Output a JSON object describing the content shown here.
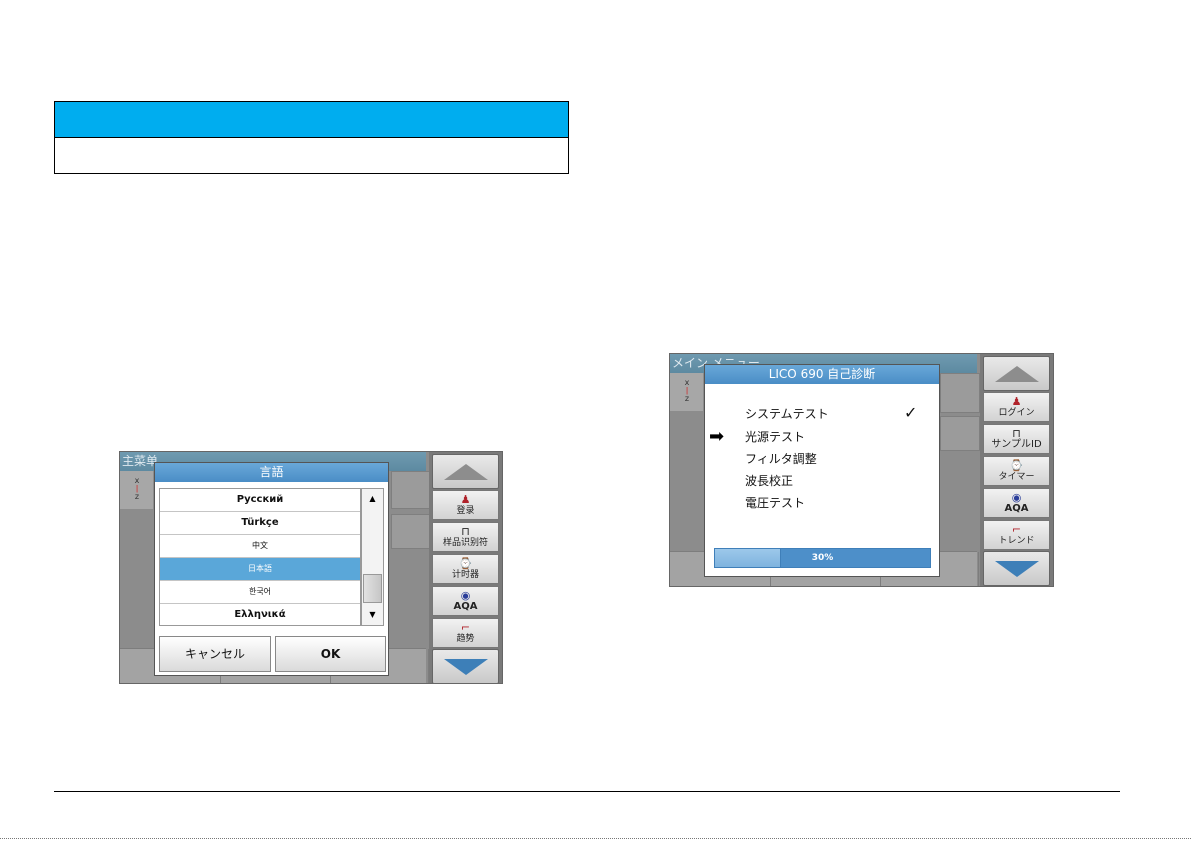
{
  "left_screen": {
    "bg_title": "主菜单",
    "bottom_labels": [
      "",
      "",
      ""
    ],
    "dialog_title": "言語",
    "languages": [
      "Русский",
      "Türkçe",
      "中文",
      "日本語",
      "한국어",
      "Ελληνικά"
    ],
    "selected_language": "日本語",
    "cancel_label": "キャンセル",
    "ok_label": "OK",
    "side": {
      "login_label": "登录",
      "sample_id_label": "样品识别符",
      "timer_label": "计时器",
      "aqa_label": "AQA",
      "trend_label": "趋势"
    }
  },
  "right_screen": {
    "bg_title": "メイン メニュー",
    "dialog_title": "LICO 690  自己診断",
    "items": [
      "システムテスト",
      "光源テスト",
      "フィルタ調整",
      "波長校正",
      "電圧テスト"
    ],
    "completed_item": "システムテスト",
    "current_item": "光源テスト",
    "progress": 0.3,
    "progress_label": "30%",
    "side": {
      "login_label": "ログイン",
      "sample_id_label": "サンプルID",
      "timer_label": "タイマー",
      "aqa_label": "AQA",
      "trend_label": "トレンド"
    }
  },
  "icons": {
    "arrow_up": "triangle-up",
    "arrow_down": "triangle-down",
    "login": "person-icon",
    "sample_id": "sample-vial-icon",
    "timer": "timer-icon",
    "aqa": "aqa-icon",
    "trend": "trend-icon",
    "check": "checkmark",
    "current": "right-arrow"
  },
  "colors": {
    "header_bar": "#00adef",
    "title_bar": "#5d8aa1",
    "dialog_title": "#4a8dc6",
    "selected_row": "#5aa7d9",
    "progress": "#4d8fc9"
  }
}
